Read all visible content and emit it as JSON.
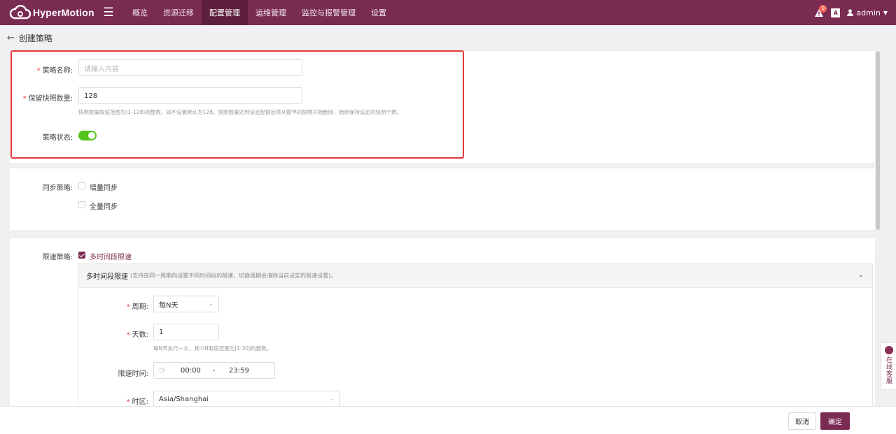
{
  "app": {
    "name": "HyperMotion"
  },
  "nav": {
    "items": [
      "概览",
      "资源迁移",
      "配置管理",
      "运维管理",
      "监控与报警管理",
      "设置"
    ],
    "active_index": 2
  },
  "topright": {
    "alert_count": "0",
    "lang_label": "A",
    "user": "admin"
  },
  "page": {
    "title": "创建策略"
  },
  "form": {
    "name": {
      "label": "策略名称:",
      "placeholder": "请输入内容"
    },
    "snapshot": {
      "label": "保留快照数量:",
      "value": "128",
      "hint": "快照数量取值范围为(1-128)的整数。如不设置默认为128。快照数量达到设定配额后将从最早的快照开始删除，始终保持设定的快照个数。"
    },
    "status": {
      "label": "策略状态:",
      "enabled": true
    },
    "sync": {
      "label": "同步策略:",
      "options": [
        {
          "label": "增量同步",
          "checked": false
        },
        {
          "label": "全量同步",
          "checked": false
        }
      ]
    },
    "limit": {
      "label": "限速策略:",
      "option": {
        "label": "多时间段限速",
        "checked": true
      },
      "panel": {
        "title": "多时间段限速",
        "subtitle": "(支持在同一周期内设置不同时间段的限速，切换周期会清除当前设定的限速设置)。",
        "period": {
          "label": "周期:",
          "value": "每N天"
        },
        "days": {
          "label": "天数:",
          "value": "1",
          "hint": "每N天执行一次，其中N取值范围为[1-30]的整数。"
        },
        "time": {
          "label": "限速时间:",
          "start": "00:00",
          "sep": "-",
          "end": "23:59"
        },
        "timezone": {
          "label": "时区:",
          "value": "Asia/Shanghai"
        }
      }
    }
  },
  "service": {
    "label": "在线客服"
  },
  "footer": {
    "cancel": "取消",
    "confirm": "确定"
  },
  "colors": {
    "brand": "#7a2b52",
    "highlight": "#e53a3a",
    "toggle_on": "#52c41a"
  }
}
